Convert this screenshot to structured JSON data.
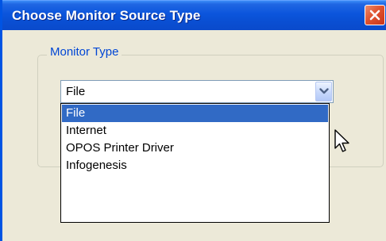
{
  "window": {
    "title": "Choose Monitor Source Type"
  },
  "group": {
    "label": "Monitor Type"
  },
  "combo": {
    "value": "File"
  },
  "dropdown": {
    "items": [
      "File",
      "Internet",
      "OPOS Printer Driver",
      "Infogenesis"
    ],
    "selected_index": 0
  },
  "icons": {
    "close": "close-icon",
    "dropdown_arrow": "chevron-down-icon",
    "cursor": "mouse-cursor-icon"
  },
  "colors": {
    "titlebar": "#0a4fd3",
    "selection": "#316ac5",
    "group_label": "#0046d5",
    "close_button": "#e0532f"
  }
}
